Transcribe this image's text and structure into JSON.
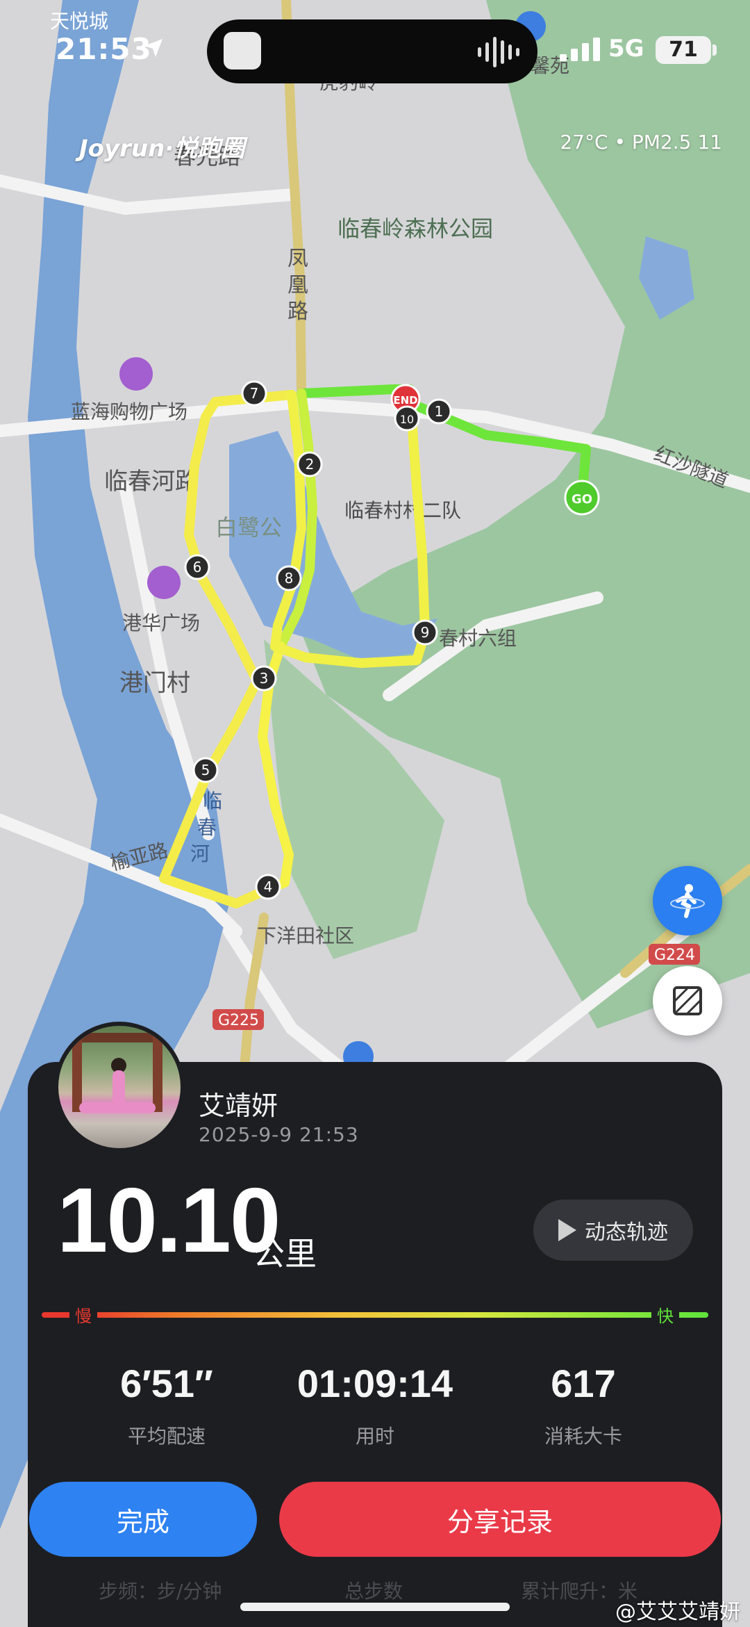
{
  "status_bar": {
    "time": "21:53",
    "network": "5G",
    "battery": "71"
  },
  "header": {
    "brand": "Joyrun·悦跑圈",
    "weather": "27°C • PM2.5 11"
  },
  "map": {
    "labels": [
      {
        "text": "天悦城"
      },
      {
        "text": "春光路"
      },
      {
        "text": "虎豹岭"
      },
      {
        "text": "馨苑"
      },
      {
        "text": "临春岭森林公园"
      },
      {
        "text": "凤凰路"
      },
      {
        "text": "蓝海购物广场"
      },
      {
        "text": "临春河路"
      },
      {
        "text": "白鹭公"
      },
      {
        "text": "临春村村二队"
      },
      {
        "text": "港华广场"
      },
      {
        "text": "港门村"
      },
      {
        "text": "春村六组"
      },
      {
        "text": "红沙隧道"
      },
      {
        "text": "临春河"
      },
      {
        "text": "榆亚路"
      },
      {
        "text": "下洋田社区"
      },
      {
        "text": "G224"
      },
      {
        "text": "G225"
      }
    ],
    "km_markers": [
      "1",
      "2",
      "3",
      "4",
      "5",
      "6",
      "7",
      "8",
      "9",
      "10"
    ],
    "start_label": "GO",
    "end_label": "END"
  },
  "card": {
    "username": "艾靖妍",
    "datetime": "2025-9-9 21:53",
    "distance": "10.10",
    "distance_unit": "公里",
    "replay_label": "动态轨迹",
    "pace_slow": "慢",
    "pace_fast": "快",
    "stats": [
      {
        "value": "6′51″",
        "label": "平均配速"
      },
      {
        "value": "01:09:14",
        "label": "用时"
      },
      {
        "value": "617",
        "label": "消耗大卡"
      }
    ],
    "done_label": "完成",
    "share_label": "分享记录",
    "ghost_labels": [
      "步频：步/分钟",
      "总步数",
      "累计爬升：米"
    ]
  },
  "watermark": "@艾艾艾靖妍",
  "colors": {
    "done": "#2e82f2",
    "share": "#ea3a48",
    "route_fast": "#5fe33b",
    "route_slow": "#f0f040"
  }
}
